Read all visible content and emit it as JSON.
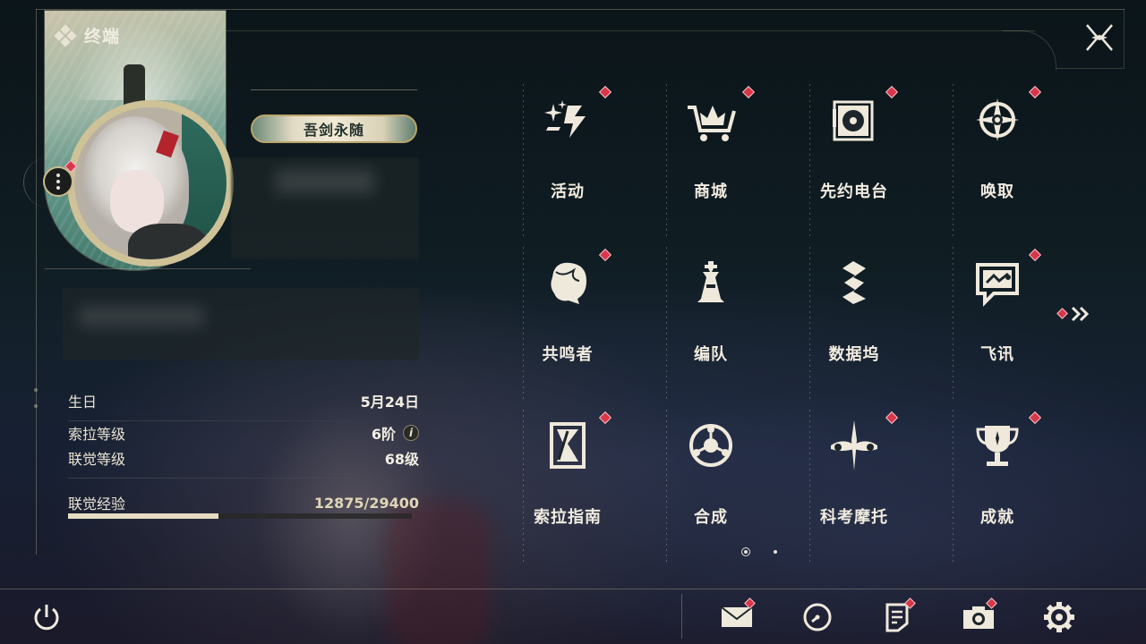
{
  "header": {
    "title": "终端",
    "close_icon": "close-x-icon"
  },
  "profile": {
    "player_title": "吾剑永随",
    "stats": {
      "birthday_label": "生日",
      "birthday_value": "5月24日",
      "sola_level_label": "索拉等级",
      "sola_level_value": "6阶",
      "union_level_label": "联觉等级",
      "union_level_value": "68级",
      "union_exp_label": "联觉经验",
      "union_exp_value": "12875/29400",
      "union_exp_fraction": 0.438
    }
  },
  "menu": {
    "items": [
      {
        "label": "活动",
        "icon": "events-icon",
        "notice": true
      },
      {
        "label": "商城",
        "icon": "shop-cart-icon",
        "notice": true
      },
      {
        "label": "先约电台",
        "icon": "radio-icon",
        "notice": true
      },
      {
        "label": "唤取",
        "icon": "convene-icon",
        "notice": true
      },
      {
        "label": "共鸣者",
        "icon": "resonator-icon",
        "notice": true
      },
      {
        "label": "编队",
        "icon": "team-icon",
        "notice": false
      },
      {
        "label": "数据坞",
        "icon": "data-bank-icon",
        "notice": false
      },
      {
        "label": "飞讯",
        "icon": "message-icon",
        "notice": true
      },
      {
        "label": "索拉指南",
        "icon": "guidebook-icon",
        "notice": true
      },
      {
        "label": "合成",
        "icon": "synthesis-icon",
        "notice": false
      },
      {
        "label": "科考摩托",
        "icon": "motorcycle-icon",
        "notice": true
      },
      {
        "label": "成就",
        "icon": "trophy-icon",
        "notice": true
      }
    ],
    "page_current": 1,
    "page_total": 2
  },
  "bottom_bar": {
    "power": "power-icon",
    "mail": "mail-icon",
    "clock": "clock-icon",
    "notes": "notes-icon",
    "camera": "camera-icon",
    "settings": "gear-icon"
  },
  "colors": {
    "accent_red": "#d8364a",
    "text_cream": "#f1ece0",
    "gold": "#cfc297"
  }
}
